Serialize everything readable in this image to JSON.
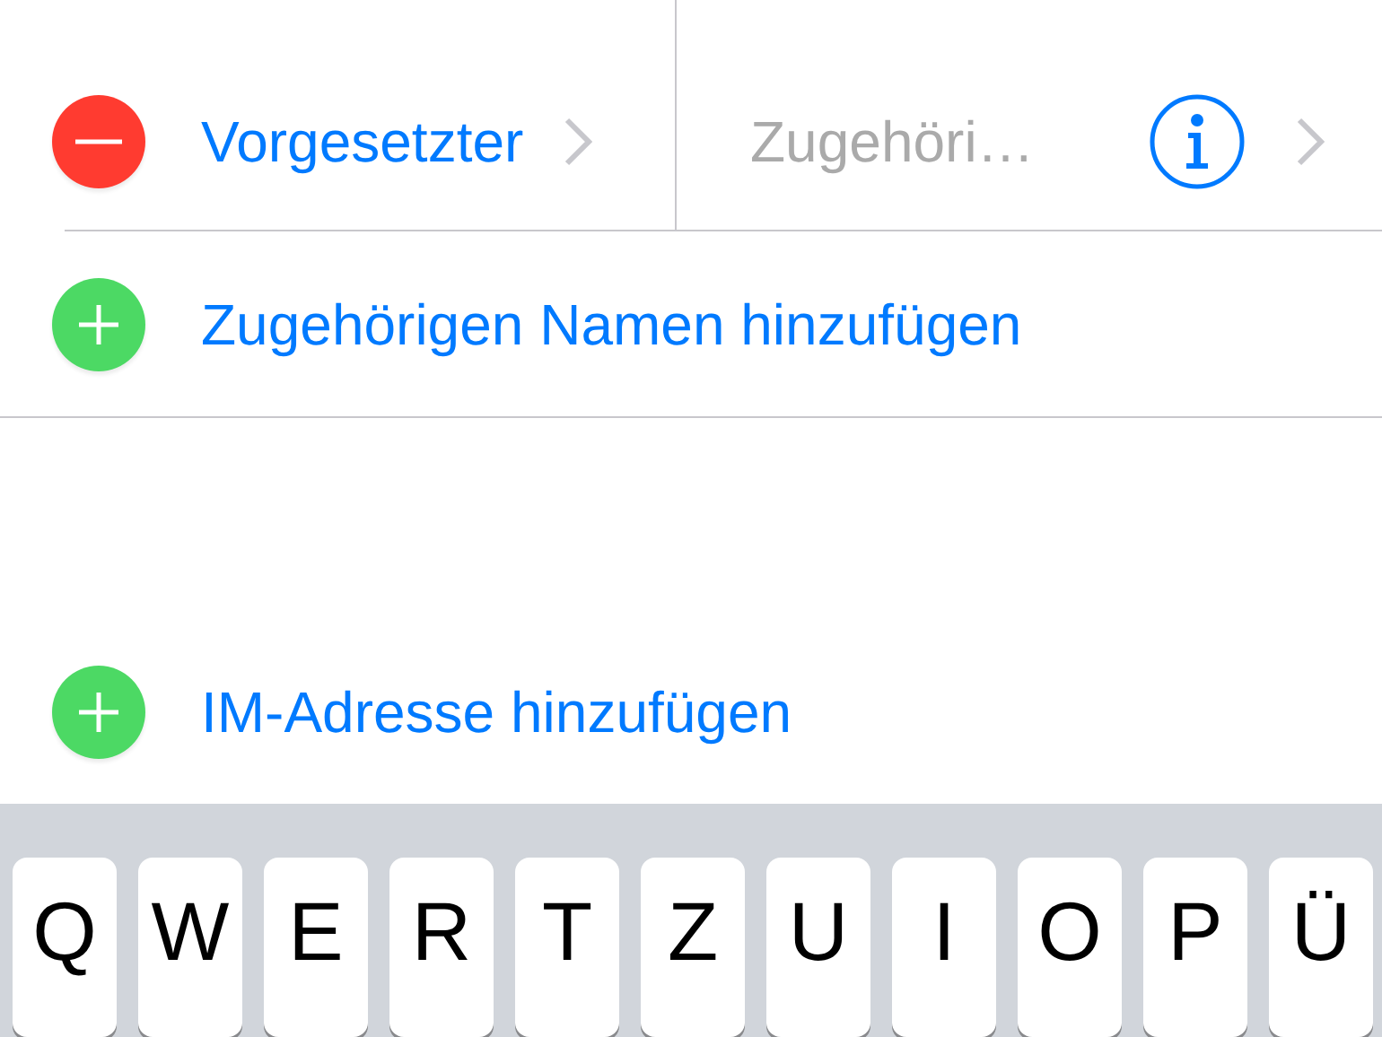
{
  "related_names": [
    {
      "label": "Vorgesetzter",
      "placeholder": "Zugehöri…"
    }
  ],
  "add_rows": [
    {
      "label": "Zugehörigen Namen hinzufügen"
    },
    {
      "label": "IM-Adresse hinzufügen"
    }
  ],
  "keyboard": {
    "keys": [
      "Q",
      "W",
      "E",
      "R",
      "T",
      "Z",
      "U",
      "I",
      "O",
      "P",
      "Ü"
    ]
  }
}
